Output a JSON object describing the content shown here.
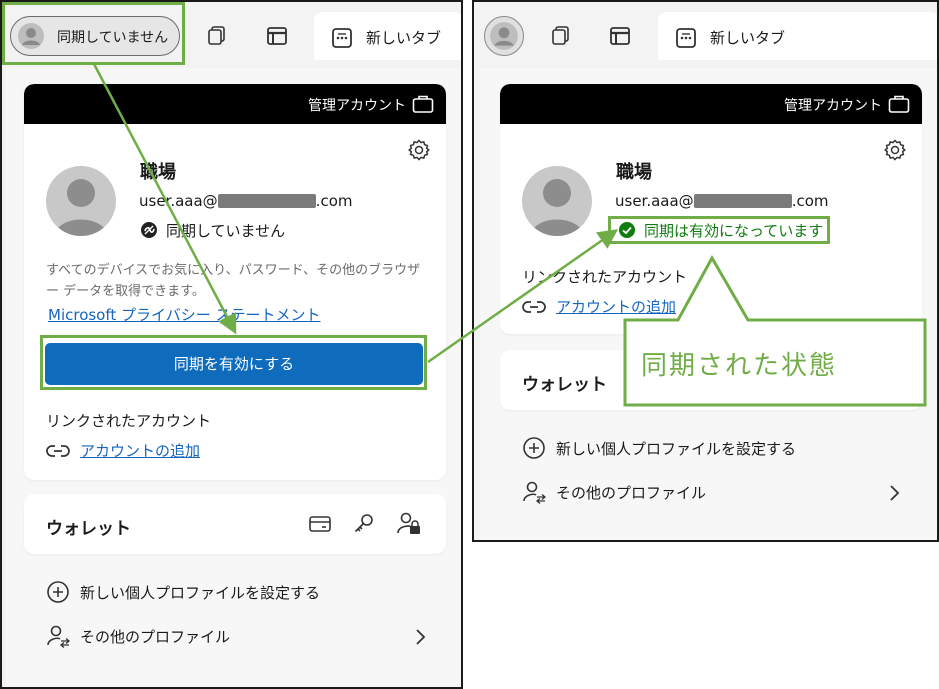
{
  "left": {
    "tabs": {
      "profile_pill": "同期していません",
      "new_tab": "新しいタブ"
    },
    "header": {
      "managed_label": "管理アカウント"
    },
    "profile": {
      "name": "職場",
      "email_prefix": "user.aaa@",
      "email_suffix": ".com",
      "sync_status": "同期していません"
    },
    "description": "すべてのデバイスでお気に入り、パスワード、その他のブラウザー データを取得できます。",
    "privacy_link": "Microsoft プライバシー ステートメント",
    "sync_button": "同期を有効にする",
    "linked_accounts": {
      "title": "リンクされたアカウント",
      "add_link": "アカウントの追加"
    },
    "wallet": {
      "title": "ウォレット"
    },
    "actions": {
      "new_profile": "新しい個人プロファイルを設定する",
      "other_profiles": "その他のプロファイル"
    }
  },
  "right": {
    "tabs": {
      "new_tab": "新しいタブ"
    },
    "header": {
      "managed_label": "管理アカウント"
    },
    "profile": {
      "name": "職場",
      "email_prefix": "user.aaa@",
      "email_suffix": ".com",
      "sync_status": "同期は有効になっています"
    },
    "linked_accounts": {
      "title": "リンクされたアカウント",
      "add_link": "アカウントの追加"
    },
    "wallet": {
      "title": "ウォレット"
    },
    "actions": {
      "new_profile": "新しい個人プロファイルを設定する",
      "other_profiles": "その他のプロファイル"
    }
  },
  "annotation": {
    "callout": "同期された状態"
  },
  "colors": {
    "annotation_green": "#70ad47",
    "sync_button_blue": "#0f6cbd",
    "link_blue": "#1565c0",
    "sync_ok_green": "#107c10"
  },
  "icons": [
    "profile-avatar-icon",
    "workspaces-icon",
    "tab-actions-icon",
    "new-tab-icon",
    "briefcase-icon",
    "gear-icon",
    "sync-off-icon",
    "check-circle-icon",
    "link-icon",
    "card-icon",
    "key-icon",
    "person-lock-icon",
    "plus-circle-icon",
    "switch-profile-icon",
    "chevron-right-icon"
  ]
}
